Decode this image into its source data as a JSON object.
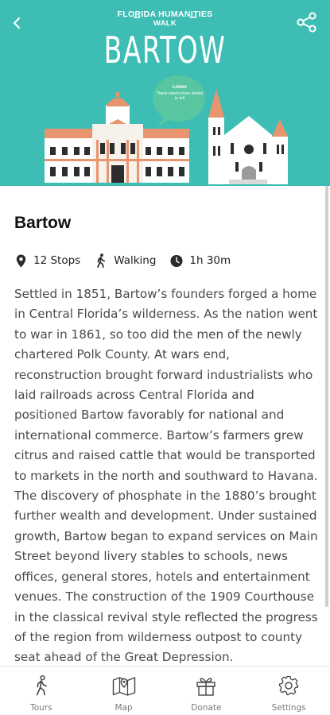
{
  "header": {
    "supertitle_line1": "FLORIDA HUMANITIES",
    "supertitle_line2": "WALK",
    "city": "BARTOW",
    "bubble_line1": "Listen",
    "bubble_line2": "These streets have stories to tell"
  },
  "colors": {
    "teal": "#3dbdb3",
    "terracotta": "#e8956f"
  },
  "icons": {
    "back": "chevron-left-icon",
    "share": "share-icon"
  },
  "tour": {
    "title": "Bartow",
    "stops": "12 Stops",
    "mode": "Walking",
    "duration": "1h 30m",
    "description": "Settled in 1851, Bartow’s founders forged a home in Central Florida’s wilderness. As the nation went to war in 1861, so too did the men of the newly chartered Polk County. At wars end, reconstruction brought forward industrialists who laid railroads across Central Florida and positioned Bartow favorably for national and international commerce. Bartow’s farmers grew citrus and raised cattle that would be transported to markets in the north and southward to Havana. The discovery of phosphate in the 1880’s brought further wealth and development. Under sustained growth, Bartow began to expand services on Main Street beyond livery stables to schools, news offices, general stores, hotels and entertainment venues. The construction of the 1909 Courthouse in the classical revival style reflected the progress of the region from wilderness outpost to county seat ahead of the Great Depression."
  },
  "nav": [
    {
      "label": "Tours",
      "icon": "walking-person-icon"
    },
    {
      "label": "Map",
      "icon": "map-icon"
    },
    {
      "label": "Donate",
      "icon": "gift-icon"
    },
    {
      "label": "Settings",
      "icon": "gear-icon"
    }
  ]
}
